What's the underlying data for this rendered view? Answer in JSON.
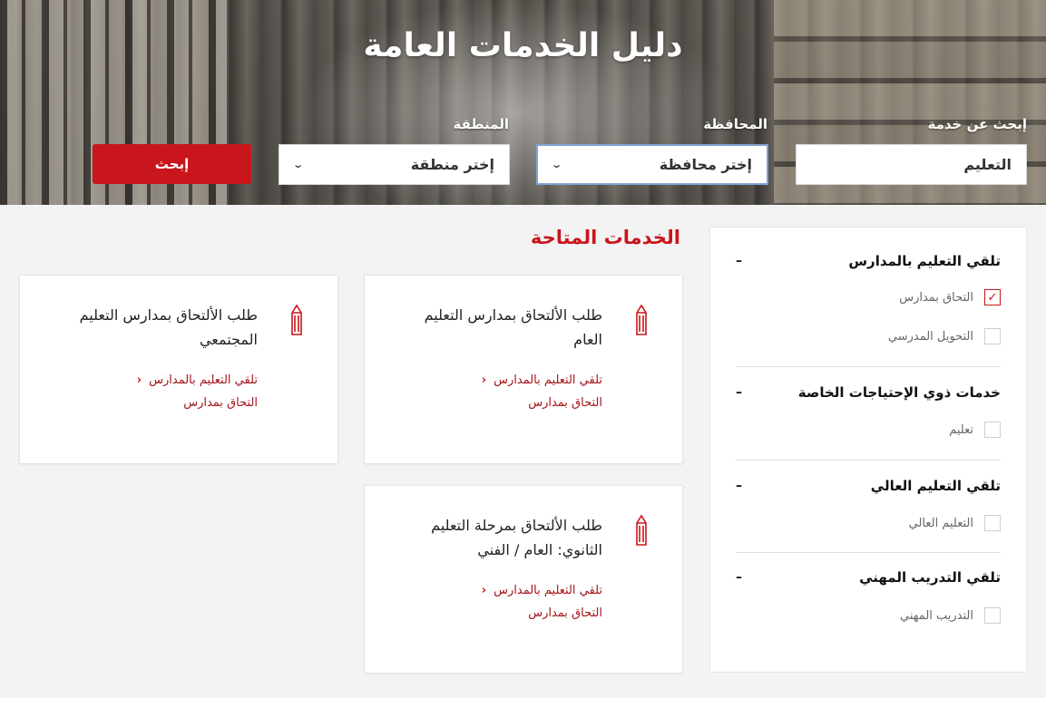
{
  "hero": {
    "title": "دليل الخدمات العامة",
    "search_label": "إبحث عن خدمة",
    "search_value": "التعليم",
    "governorate_label": "المحافظة",
    "governorate_value": "إختر محافظة",
    "region_label": "المنطقة",
    "region_value": "إختر منطقة",
    "search_button": "إبحث"
  },
  "filters": {
    "groups": [
      {
        "title": "تلقي التعليم بالمدارس",
        "toggle": "–",
        "options": [
          {
            "label": "التحاق بمدارس",
            "checked": true
          },
          {
            "label": "التحويل المدرسي",
            "checked": false
          }
        ]
      },
      {
        "title": "خدمات ذوي الإحتياجات الخاصة",
        "toggle": "–",
        "options": [
          {
            "label": "تعليم",
            "checked": false
          }
        ]
      },
      {
        "title": "تلقي التعليم العالي",
        "toggle": "–",
        "options": [
          {
            "label": "التعليم العالي",
            "checked": false
          }
        ]
      },
      {
        "title": "تلقي التدريب المهني",
        "toggle": "–",
        "options": [
          {
            "label": "التدريب المهني",
            "checked": false
          }
        ]
      }
    ]
  },
  "services": {
    "title": "الخدمات المتاحة",
    "cards": [
      {
        "title": "طلب الألتحاق بمدارس التعليم العام",
        "category": "تلقي التعليم بالمدارس",
        "subcategory": "التحاق بمدارس"
      },
      {
        "title": "طلب الألتحاق بمدارس التعليم المجتمعي",
        "category": "تلقي التعليم بالمدارس",
        "subcategory": "التحاق بمدارس"
      },
      {
        "title": "طلب الألتحاق بمرحلة التعليم الثانوي: العام / الفني",
        "category": "تلقي التعليم بالمدارس",
        "subcategory": "التحاق بمدارس"
      }
    ]
  },
  "icons": {
    "card_icon": "pencil-icon",
    "link_arrow": "chevron-left-icon",
    "select_arrow": "chevron-down-icon",
    "check": "checkmark-icon"
  },
  "colors": {
    "accent": "#c9161c",
    "link": "#a5141a"
  }
}
